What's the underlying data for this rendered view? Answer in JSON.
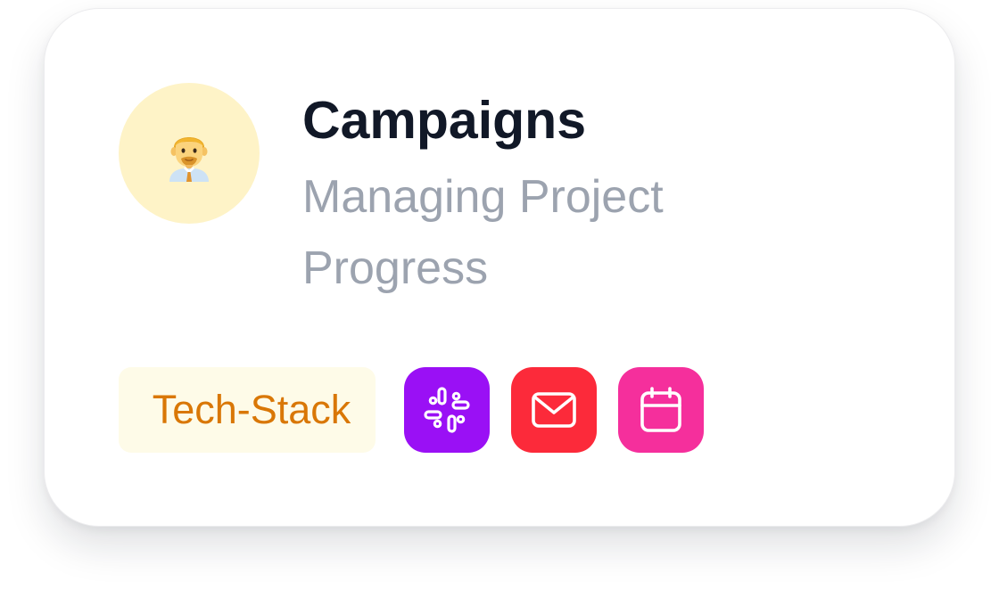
{
  "card": {
    "avatar": {
      "icon": "man-office-worker-icon",
      "background": "#fef3c7"
    },
    "title": "Campaigns",
    "subtitle": "Managing Project Progress",
    "tag": {
      "label": "Tech-Stack",
      "text_color": "#d97706",
      "background": "#fefbe8"
    },
    "apps": [
      {
        "icon": "slack-icon",
        "color": "#9a10f5"
      },
      {
        "icon": "mail-icon",
        "color": "#fc2a3a"
      },
      {
        "icon": "calendar-icon",
        "color": "#f52f9c"
      }
    ]
  }
}
